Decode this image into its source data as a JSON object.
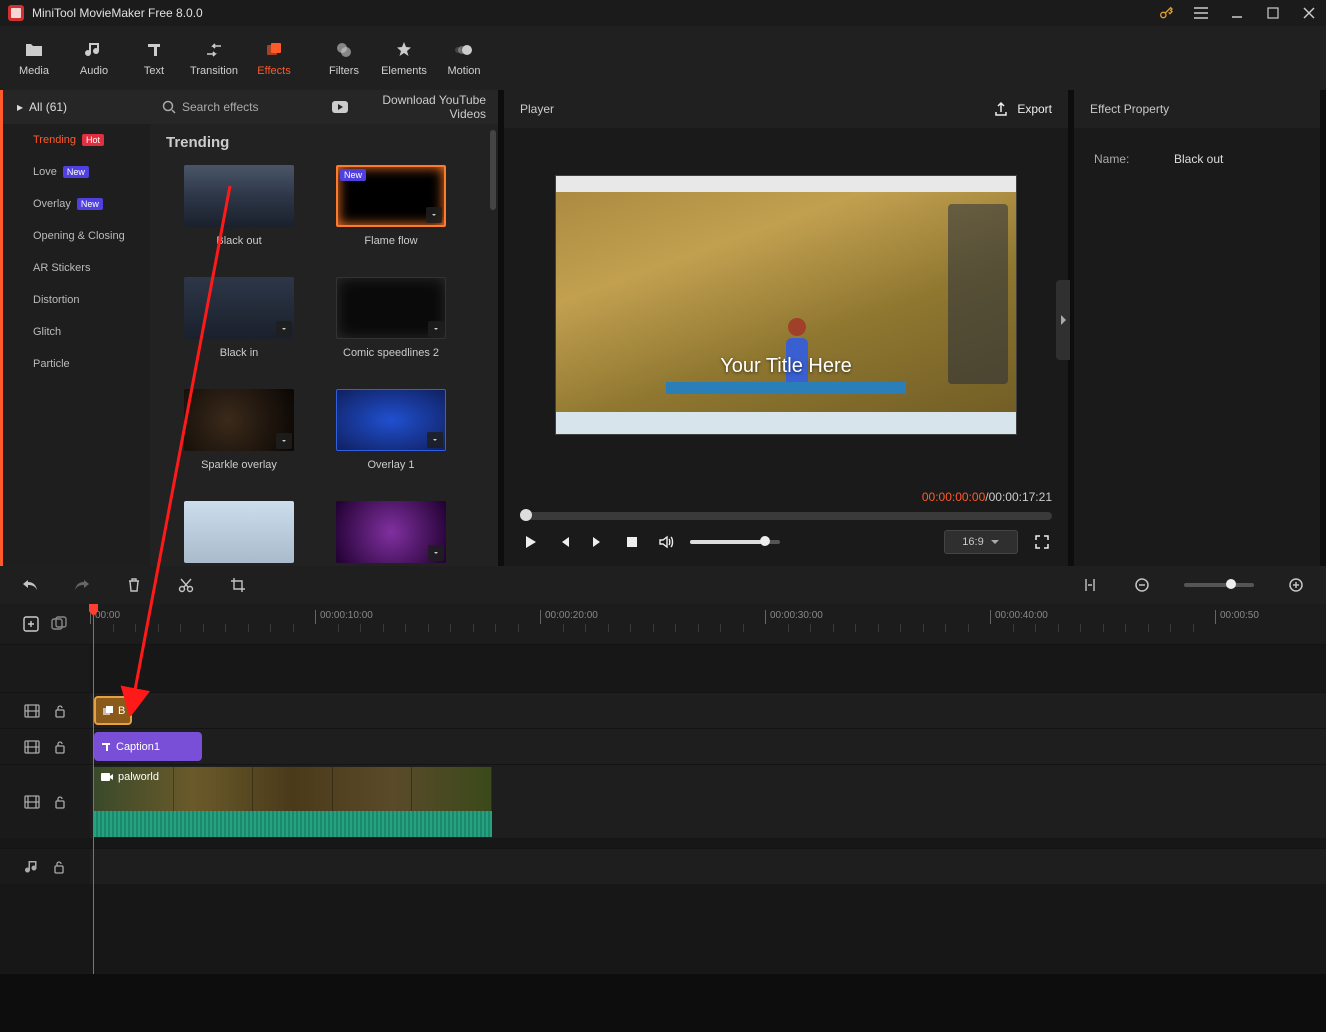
{
  "titlebar": {
    "title": "MiniTool MovieMaker Free 8.0.0"
  },
  "toolbar": {
    "media": "Media",
    "audio": "Audio",
    "text": "Text",
    "transition": "Transition",
    "effects": "Effects",
    "filters": "Filters",
    "elements": "Elements",
    "motion": "Motion"
  },
  "sidebar": {
    "header": "All (61)",
    "items": [
      {
        "label": "Trending",
        "badge": "Hot",
        "badgeClass": "hot",
        "selected": true
      },
      {
        "label": "Love",
        "badge": "New",
        "badgeClass": "new"
      },
      {
        "label": "Overlay",
        "badge": "New",
        "badgeClass": "new"
      },
      {
        "label": "Opening & Closing"
      },
      {
        "label": "AR Stickers"
      },
      {
        "label": "Distortion"
      },
      {
        "label": "Glitch"
      },
      {
        "label": "Particle"
      }
    ]
  },
  "effects": {
    "search_placeholder": "Search effects",
    "download_label": "Download YouTube Videos",
    "heading": "Trending",
    "cards": [
      {
        "label": "Black out"
      },
      {
        "label": "Flame flow",
        "new": true,
        "dl": true
      },
      {
        "label": "Black in",
        "dl": true
      },
      {
        "label": "Comic speedlines 2",
        "dl": true
      },
      {
        "label": "Sparkle overlay",
        "dl": true
      },
      {
        "label": "Overlay 1",
        "dl": true
      },
      {
        "label": "",
        "dl": false
      },
      {
        "label": "",
        "dl": true
      }
    ]
  },
  "player": {
    "title": "Player",
    "export": "Export",
    "preview_title": "Your Title Here",
    "time_current": "00:00:00:00",
    "time_sep": " / ",
    "time_total": "00:00:17:21",
    "ratio": "16:9"
  },
  "property": {
    "header": "Effect Property",
    "name_key": "Name:",
    "name_val": "Black out"
  },
  "timeline": {
    "ticks": [
      "00:00",
      "00:00:10:00",
      "00:00:20:00",
      "00:00:30:00",
      "00:00:40:00",
      "00:00:50"
    ],
    "effect_clip": "B",
    "caption_clip": "Caption1",
    "video_clip": "palworld"
  }
}
